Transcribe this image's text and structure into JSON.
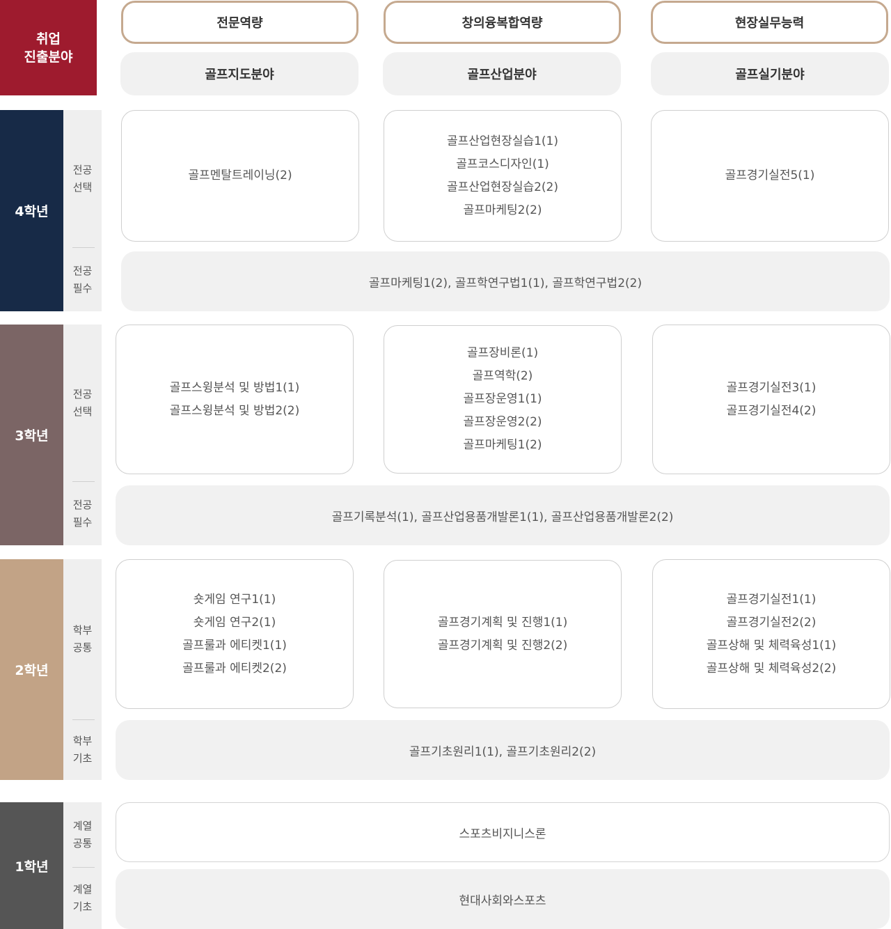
{
  "colors": {
    "corner": "#9e1b2e",
    "year4": "#172a47",
    "year3": "#7b6565",
    "year2": "#c2a386",
    "year1": "#555555",
    "competency_border": "#c5a98f"
  },
  "corner_label": "취업\n진출분야",
  "competencies": [
    "전문역량",
    "창의융복합역량",
    "현장실무능력"
  ],
  "fields": [
    "골프지도분야",
    "골프산업분야",
    "골프실기분야"
  ],
  "years": {
    "y4": {
      "label": "4학년",
      "cat_top": "전공\n선택",
      "cat_bottom": "전공\n필수",
      "boxes": [
        [
          "골프멘탈트레이닝(2)"
        ],
        [
          "골프산업현장실습1(1)",
          "골프코스디자인(1)",
          "골프산업현장실습2(2)",
          "골프마케팅2(2)"
        ],
        [
          "골프경기실전5(1)"
        ]
      ],
      "required": "골프마케팅1(2), 골프학연구법1(1), 골프학연구법2(2)"
    },
    "y3": {
      "label": "3학년",
      "cat_top": "전공\n선택",
      "cat_bottom": "전공\n필수",
      "boxes": [
        [
          "골프스윙분석 및 방법1(1)",
          "골프스윙분석 및 방법2(2)"
        ],
        [
          "골프장비론(1)",
          "골프역학(2)",
          "골프장운영1(1)",
          "골프장운영2(2)",
          "골프마케팅1(2)"
        ],
        [
          "골프경기실전3(1)",
          "골프경기실전4(2)"
        ]
      ],
      "required": "골프기록분석(1), 골프산업용품개발론1(1), 골프산업용품개발론2(2)"
    },
    "y2": {
      "label": "2학년",
      "cat_top": "학부\n공통",
      "cat_bottom": "학부\n기초",
      "boxes": [
        [
          "숏게임 연구1(1)",
          "숏게임 연구2(1)",
          "골프룰과 에티켓1(1)",
          "골프룰과 에티켓2(2)"
        ],
        [
          "골프경기계획 및 진행1(1)",
          "골프경기계획 및 진행2(2)"
        ],
        [
          "골프경기실전1(1)",
          "골프경기실전2(2)",
          "골프상해 및 체력육성1(1)",
          "골프상해 및 체력육성2(2)"
        ]
      ],
      "required": "골프기초원리1(1), 골프기초원리2(2)"
    },
    "y1": {
      "label": "1학년",
      "cat_top": "계열\n공통",
      "cat_bottom": "계열\n기초",
      "common": "스포츠비지니스론",
      "basic": "현대사회와스포츠"
    }
  }
}
